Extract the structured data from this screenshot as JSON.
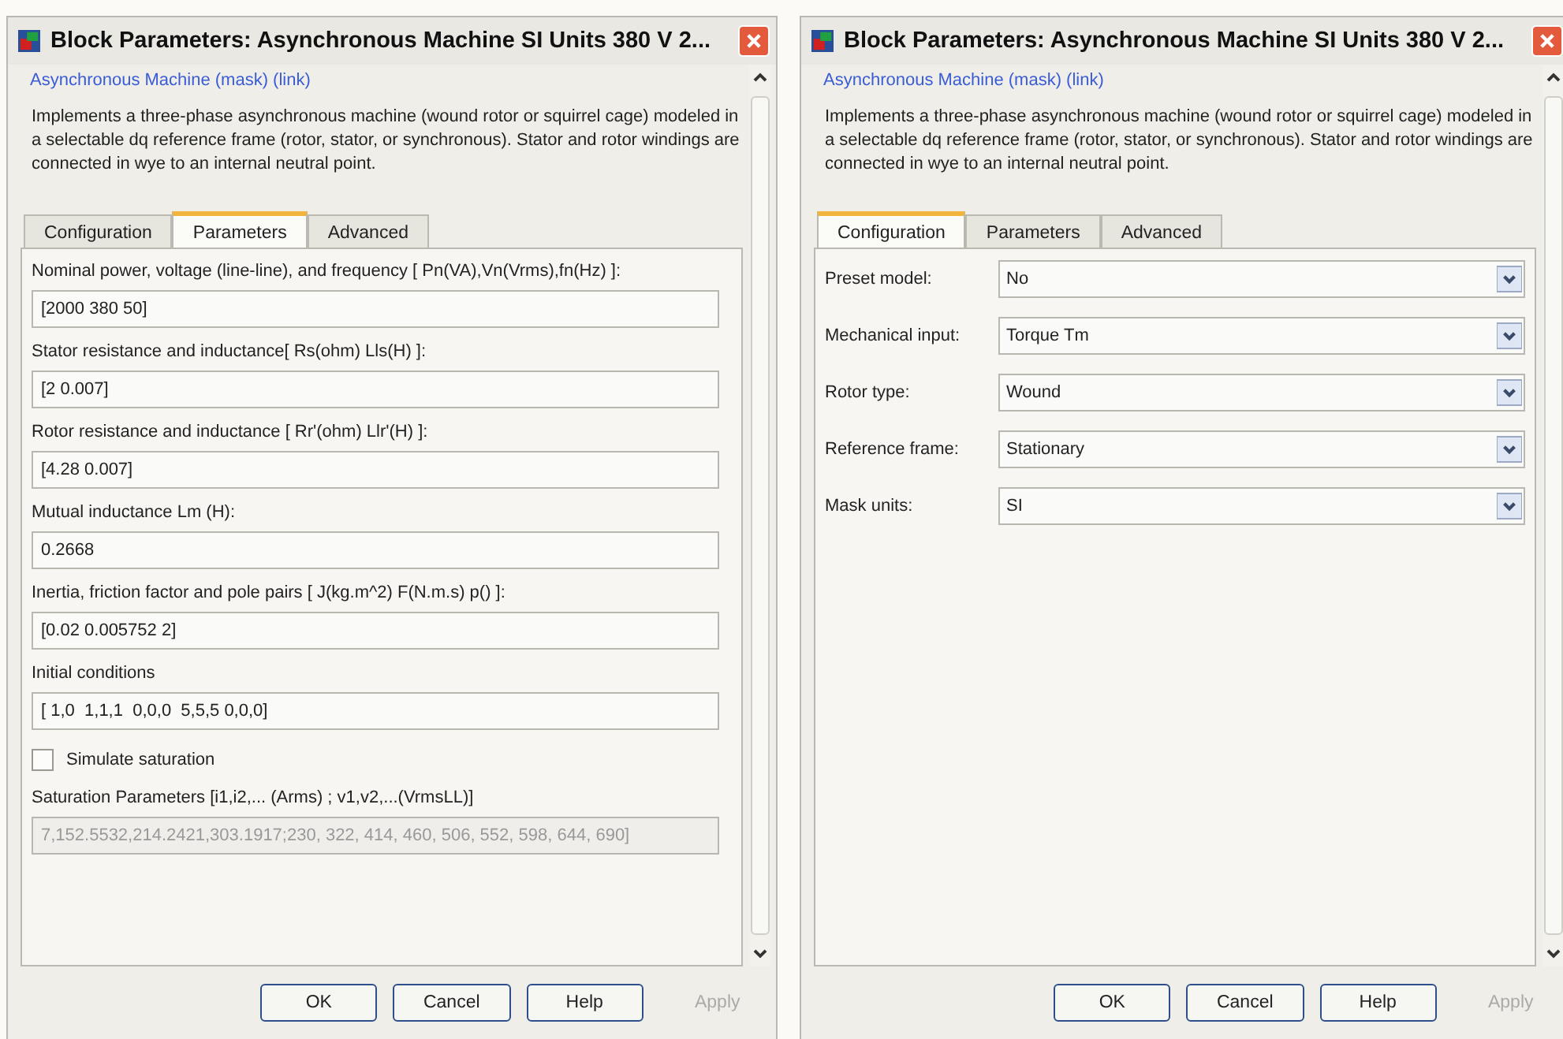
{
  "windows": [
    {
      "title": "Block Parameters: Asynchronous Machine SI Units 380 V 2...",
      "link": "Asynchronous Machine (mask) (link)",
      "description": "Implements a three-phase asynchronous machine (wound rotor or squirrel cage) modeled in a selectable  dq reference frame (rotor, stator, or synchronous). Stator and rotor windings are connected in wye to an internal neutral point.",
      "tabs": [
        {
          "label": "Configuration",
          "selected": false
        },
        {
          "label": "Parameters",
          "selected": true
        },
        {
          "label": "Advanced",
          "selected": false
        }
      ],
      "items": [
        {
          "kind": "field",
          "label": "Nominal power, voltage (line-line), and frequency [ Pn(VA),Vn(Vrms),fn(Hz) ]:",
          "value": "[2000 380 50]",
          "disabled": false
        },
        {
          "kind": "field",
          "label": "Stator resistance and inductance[ Rs(ohm)  Lls(H) ]:",
          "value": "[2 0.007]",
          "disabled": false
        },
        {
          "kind": "field",
          "label": "Rotor resistance and inductance [ Rr'(ohm)  Llr'(H) ]:",
          "value": "[4.28 0.007]",
          "disabled": false
        },
        {
          "kind": "field",
          "label": "Mutual inductance Lm (H):",
          "value": "0.2668",
          "disabled": false
        },
        {
          "kind": "field",
          "label": "Inertia, friction factor and pole pairs [ J(kg.m^2)  F(N.m.s)  p() ]:",
          "value": "[0.02 0.005752 2]",
          "disabled": false
        },
        {
          "kind": "field",
          "label": "Initial conditions",
          "value": "[ 1,0  1,1,1  0,0,0  5,5,5 0,0,0]",
          "disabled": false
        },
        {
          "kind": "checkbox",
          "label": "Simulate saturation",
          "checked": false
        },
        {
          "kind": "field",
          "label": "Saturation Parameters [i1,i2,... (Arms) ; v1,v2,...(VrmsLL)]",
          "value": "7,152.5532,214.2421,303.1917;230, 322, 414, 460, 506, 552, 598, 644, 690]",
          "disabled": true
        }
      ],
      "buttons": [
        {
          "label": "OK",
          "disabled": false
        },
        {
          "label": "Cancel",
          "disabled": false
        },
        {
          "label": "Help",
          "disabled": false
        },
        {
          "label": "Apply",
          "disabled": true
        }
      ]
    },
    {
      "title": "Block Parameters: Asynchronous Machine SI Units 380 V 2...",
      "link": "Asynchronous Machine (mask) (link)",
      "description": "Implements a three-phase asynchronous machine (wound rotor or squirrel cage) modeled in a selectable  dq reference frame (rotor, stator, or synchronous). Stator and rotor windings are connected in wye to an internal neutral point.",
      "tabs": [
        {
          "label": "Configuration",
          "selected": true
        },
        {
          "label": "Parameters",
          "selected": false
        },
        {
          "label": "Advanced",
          "selected": false
        }
      ],
      "items": [
        {
          "kind": "dropdown",
          "label": "Preset model:",
          "value": "No"
        },
        {
          "kind": "dropdown",
          "label": "Mechanical input:",
          "value": "Torque Tm"
        },
        {
          "kind": "dropdown",
          "label": "Rotor type:",
          "value": "Wound"
        },
        {
          "kind": "dropdown",
          "label": "Reference frame:",
          "value": "Stationary"
        },
        {
          "kind": "dropdown",
          "label": "Mask units:",
          "value": "SI"
        }
      ],
      "buttons": [
        {
          "label": "OK",
          "disabled": false
        },
        {
          "label": "Cancel",
          "disabled": false
        },
        {
          "label": "Help",
          "disabled": false
        },
        {
          "label": "Apply",
          "disabled": true
        }
      ]
    }
  ]
}
